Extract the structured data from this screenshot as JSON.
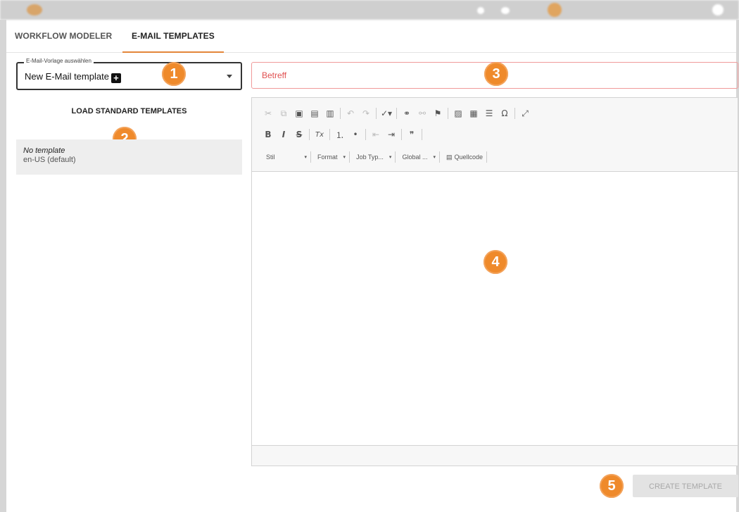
{
  "tabs": [
    {
      "label": "WORKFLOW MODELER"
    },
    {
      "label": "E-MAIL TEMPLATES"
    }
  ],
  "template_select": {
    "legend": "E-Mail-Vorlage auswählen",
    "value": "New E-Mail template",
    "plus_glyph": "+",
    "badge": "1"
  },
  "load_standard": {
    "label": "LOAD STANDARD TEMPLATES",
    "badge": "2"
  },
  "template_list": [
    {
      "name": "No template",
      "locale": "en-US (default)"
    }
  ],
  "subject": {
    "placeholder": "Betreff",
    "value": "",
    "badge": "3"
  },
  "editor": {
    "badge": "4",
    "toolbar_row1": [
      {
        "icon": "cut-icon",
        "glyph": "✂",
        "disabled": true
      },
      {
        "icon": "copy-icon",
        "glyph": "⧉",
        "disabled": true
      },
      {
        "icon": "paste-icon",
        "glyph": "▣",
        "disabled": false
      },
      {
        "icon": "paste-text-icon",
        "glyph": "▤",
        "disabled": false
      },
      {
        "icon": "paste-word-icon",
        "glyph": "▥",
        "disabled": false
      },
      {
        "sep": true
      },
      {
        "icon": "undo-icon",
        "glyph": "↶",
        "disabled": true
      },
      {
        "icon": "redo-icon",
        "glyph": "↷",
        "disabled": true
      },
      {
        "sep": true
      },
      {
        "icon": "spellcheck-icon",
        "glyph": "✓▾",
        "disabled": false
      },
      {
        "sep": true
      },
      {
        "icon": "link-icon",
        "glyph": "⚭",
        "disabled": false
      },
      {
        "icon": "unlink-icon",
        "glyph": "⚯",
        "disabled": true
      },
      {
        "icon": "anchor-flag-icon",
        "glyph": "⚑",
        "disabled": false
      },
      {
        "sep": true
      },
      {
        "icon": "image-icon",
        "glyph": "▨",
        "disabled": false
      },
      {
        "icon": "table-icon",
        "glyph": "▦",
        "disabled": false
      },
      {
        "icon": "horizontal-line-icon",
        "glyph": "☰",
        "disabled": false
      },
      {
        "icon": "special-char-icon",
        "glyph": "Ω",
        "disabled": false
      },
      {
        "sep": true
      },
      {
        "icon": "maximize-icon",
        "glyph": "⤢",
        "disabled": false
      }
    ],
    "toolbar_row2": [
      {
        "icon": "bold-icon",
        "glyph": "B",
        "disabled": false
      },
      {
        "icon": "italic-icon",
        "glyph": "I",
        "disabled": false
      },
      {
        "icon": "strike-icon",
        "glyph": "S",
        "disabled": false
      },
      {
        "sep": true
      },
      {
        "icon": "remove-format-icon",
        "glyph": "Tx",
        "disabled": false
      },
      {
        "sep": true
      },
      {
        "icon": "numbered-list-icon",
        "glyph": "⒈",
        "disabled": false
      },
      {
        "icon": "bulleted-list-icon",
        "glyph": "•",
        "disabled": false
      },
      {
        "sep": true
      },
      {
        "icon": "outdent-icon",
        "glyph": "⇤",
        "disabled": true
      },
      {
        "icon": "indent-icon",
        "glyph": "⇥",
        "disabled": false
      },
      {
        "sep": true
      },
      {
        "icon": "blockquote-icon",
        "glyph": "❞",
        "disabled": false
      },
      {
        "sep": true
      }
    ],
    "toolbar_row3": [
      {
        "label": "Stil",
        "dropdown": true
      },
      {
        "label": "Format",
        "dropdown": true
      },
      {
        "label": "Job Typ...",
        "dropdown": true
      },
      {
        "label": "Global ...",
        "dropdown": true
      },
      {
        "label": "Quellcode",
        "dropdown": false,
        "icon": "source-code-icon"
      }
    ]
  },
  "create_button": {
    "label": "CREATE TEMPLATE",
    "badge": "5"
  },
  "colors": {
    "accent": "#e4863a",
    "badge": "#ef8a2b",
    "subject_border": "#f09a9a"
  }
}
